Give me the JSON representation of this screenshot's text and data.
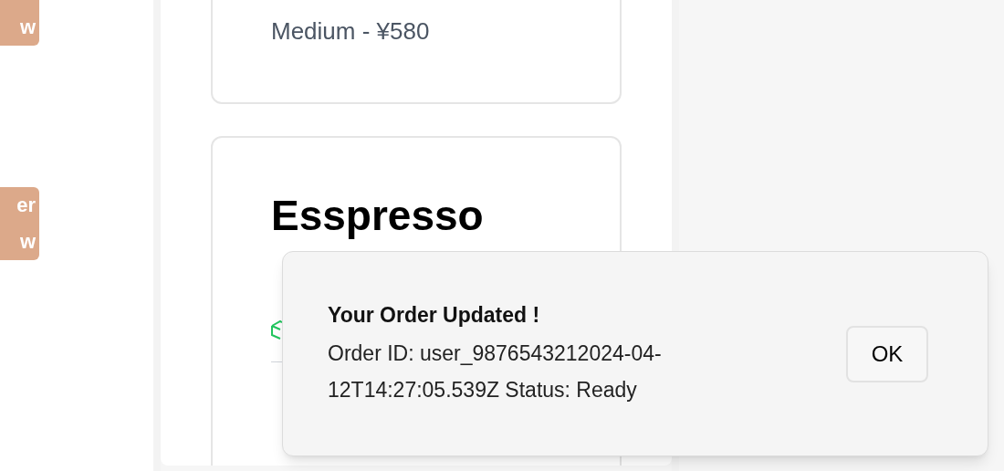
{
  "side_buttons": [
    {
      "label": "w"
    },
    {
      "label": "er\nw"
    }
  ],
  "cards": [
    {
      "variant": "Medium - ¥580"
    },
    {
      "title": "Esspresso"
    }
  ],
  "dialog": {
    "title": "Your Order Updated !",
    "message": "Order ID: user_9876543212024-04-12T14:27:05.539Z Status: Ready",
    "button": "OK"
  }
}
